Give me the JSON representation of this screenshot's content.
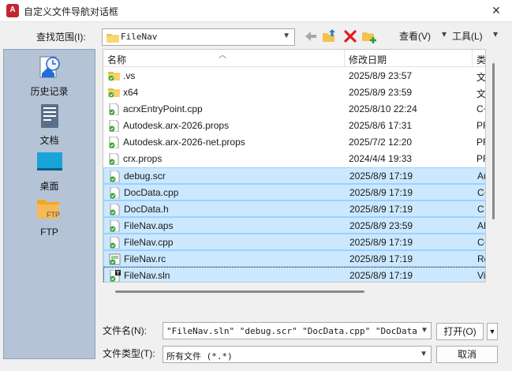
{
  "window": {
    "title": "自定义文件导航对话框",
    "app_icon_letter": "A"
  },
  "lookin": {
    "label": "查找范围(I):",
    "value": "FileNav"
  },
  "toolbar": {
    "view_label": "查看(V)",
    "tools_label": "工具(L)"
  },
  "places": [
    {
      "label": "历史记录",
      "icon": "history-icon"
    },
    {
      "label": "文档",
      "icon": "documents-icon"
    },
    {
      "label": "桌面",
      "icon": "desktop-icon"
    },
    {
      "label": "FTP",
      "icon": "ftp-icon"
    }
  ],
  "columns": {
    "name": "名称",
    "date": "修改日期",
    "type": "类"
  },
  "files": [
    {
      "name": ".vs",
      "date": "2025/8/9 23:57",
      "type": "文",
      "icon": "folder-icon",
      "selected": false
    },
    {
      "name": "x64",
      "date": "2025/8/9 23:59",
      "type": "文",
      "icon": "folder-icon",
      "selected": false
    },
    {
      "name": "acrxEntryPoint.cpp",
      "date": "2025/8/10 22:24",
      "type": "C+",
      "icon": "file-icon",
      "selected": false
    },
    {
      "name": "Autodesk.arx-2026.props",
      "date": "2025/8/6 17:31",
      "type": "PR",
      "icon": "file-icon",
      "selected": false
    },
    {
      "name": "Autodesk.arx-2026-net.props",
      "date": "2025/7/2 12:20",
      "type": "PR",
      "icon": "file-icon",
      "selected": false
    },
    {
      "name": "crx.props",
      "date": "2024/4/4 19:33",
      "type": "PR",
      "icon": "file-icon",
      "selected": false
    },
    {
      "name": "debug.scr",
      "date": "2025/8/9 17:19",
      "type": "Au",
      "icon": "file-icon",
      "selected": true
    },
    {
      "name": "DocData.cpp",
      "date": "2025/8/9 17:19",
      "type": "C+",
      "icon": "file-icon",
      "selected": true
    },
    {
      "name": "DocData.h",
      "date": "2025/8/9 17:19",
      "type": "C",
      "icon": "file-icon",
      "selected": true
    },
    {
      "name": "FileNav.aps",
      "date": "2025/8/9 23:59",
      "type": "AP",
      "icon": "file-icon",
      "selected": true
    },
    {
      "name": "FileNav.cpp",
      "date": "2025/8/9 17:19",
      "type": "C+",
      "icon": "file-icon",
      "selected": true
    },
    {
      "name": "FileNav.rc",
      "date": "2025/8/9 17:19",
      "type": "Re",
      "icon": "rc-file-icon",
      "selected": true
    },
    {
      "name": "FileNav.sln",
      "date": "2025/8/9 17:19",
      "type": "Vis",
      "icon": "sln-file-icon",
      "selected": true
    }
  ],
  "filename": {
    "label": "文件名(N):",
    "value": "\"FileNav.sln\" \"debug.scr\" \"DocData.cpp\" \"DocData.h\" \"FileN"
  },
  "filetype": {
    "label": "文件类型(T):",
    "value": "所有文件 (*.*)"
  },
  "buttons": {
    "open": "打开(O)",
    "cancel": "取消"
  }
}
